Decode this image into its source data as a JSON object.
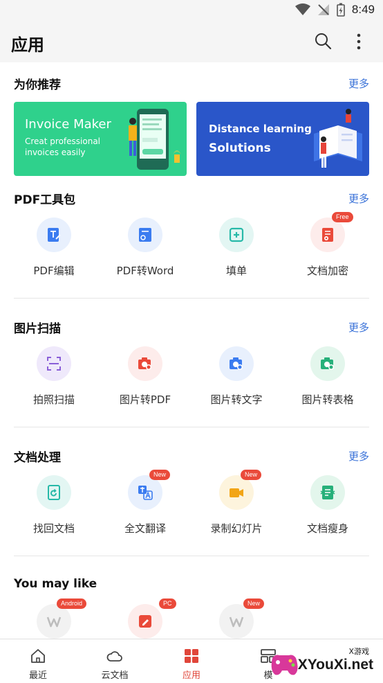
{
  "status": {
    "time": "8:49"
  },
  "header": {
    "title": "应用"
  },
  "recommend": {
    "title": "为你推荐",
    "more": "更多",
    "banners": [
      {
        "title": "Invoice Maker",
        "subtitle_1": "Creat professional",
        "subtitle_2": "invoices easily",
        "color": "#2fd18c"
      },
      {
        "title_1": "Distance learning",
        "title_2": "Solutions",
        "color": "#2a56c9"
      }
    ]
  },
  "pdf_tools": {
    "title": "PDF工具包",
    "more": "更多",
    "items": [
      {
        "label": "PDF编辑",
        "icon": "pdf-edit-icon",
        "color": "#3b7cf0"
      },
      {
        "label": "PDF转Word",
        "icon": "pdf-to-word-icon",
        "color": "#3b7cf0"
      },
      {
        "label": "填单",
        "icon": "fill-form-icon",
        "color": "#27b9a8"
      },
      {
        "label": "文档加密",
        "icon": "encrypt-doc-icon",
        "color": "#ea4a3a",
        "badge": "Free"
      }
    ]
  },
  "image_scan": {
    "title": "图片扫描",
    "more": "更多",
    "items": [
      {
        "label": "拍照扫描",
        "icon": "photo-scan-icon",
        "color": "#8a5fd8"
      },
      {
        "label": "图片转PDF",
        "icon": "image-to-pdf-icon",
        "color": "#ea4a3a"
      },
      {
        "label": "图片转文字",
        "icon": "image-to-text-icon",
        "color": "#3b7cf0"
      },
      {
        "label": "图片转表格",
        "icon": "image-to-table-icon",
        "color": "#27b07a"
      }
    ]
  },
  "doc_process": {
    "title": "文档处理",
    "more": "更多",
    "items": [
      {
        "label": "找回文档",
        "icon": "recover-doc-icon",
        "color": "#27b9a8"
      },
      {
        "label": "全文翻译",
        "icon": "translate-icon",
        "color": "#3b7cf0",
        "badge": "New"
      },
      {
        "label": "录制幻灯片",
        "icon": "record-slides-icon",
        "color": "#f2a516",
        "badge": "New"
      },
      {
        "label": "文档瘦身",
        "icon": "slim-doc-icon",
        "color": "#27b07a"
      }
    ]
  },
  "may_like": {
    "title": "You may like",
    "items": [
      {
        "icon": "wps-icon",
        "badge": "Android"
      },
      {
        "icon": "edit-note-icon",
        "badge": "PC"
      },
      {
        "icon": "wps-icon",
        "badge": "New"
      }
    ]
  },
  "nav": {
    "items": [
      {
        "label": "最近",
        "icon": "home-icon"
      },
      {
        "label": "云文档",
        "icon": "cloud-icon"
      },
      {
        "label": "应用",
        "icon": "apps-icon",
        "active": true
      },
      {
        "label": "模",
        "icon": "template-icon"
      }
    ]
  },
  "watermark": {
    "text": "XYouXi.net",
    "small": "X游戏"
  }
}
